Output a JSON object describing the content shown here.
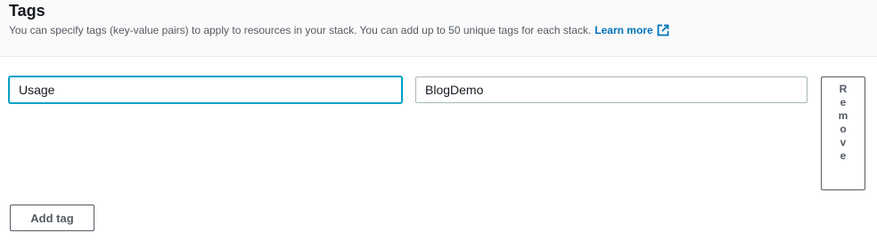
{
  "section": {
    "title": "Tags",
    "description": "You can specify tags (key-value pairs) to apply to resources in your stack. You can add up to 50 unique tags for each stack.",
    "learn_more": "Learn more",
    "learn_more_icon": "external-link-icon"
  },
  "tags": [
    {
      "key": "Usage",
      "value": "BlogDemo",
      "remove_label": "Remove"
    }
  ],
  "add_tag_label": "Add tag",
  "colors": {
    "link": "#0073bb",
    "focus": "#00a1c9",
    "button_text": "#545b64"
  }
}
